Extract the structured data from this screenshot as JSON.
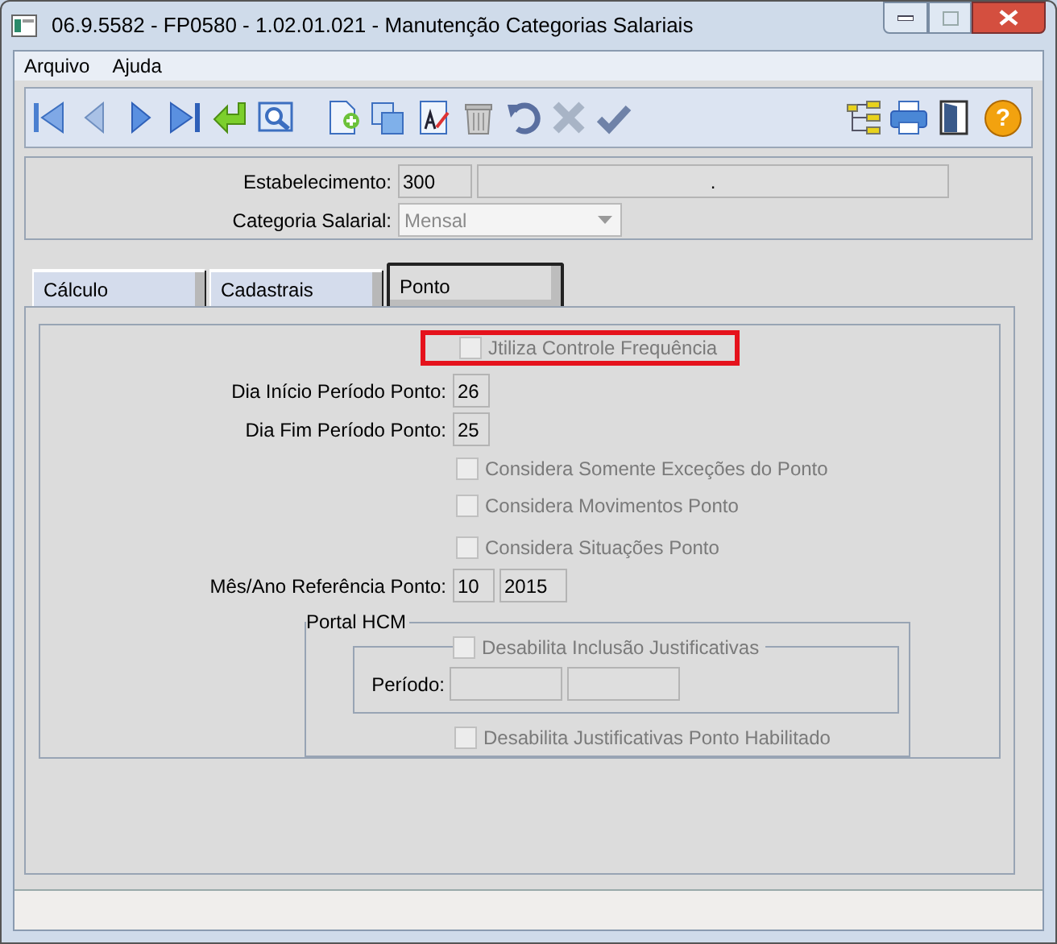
{
  "window": {
    "title": "06.9.5582 - FP0580 - 1.02.01.021 - Manutenção Categorias Salariais"
  },
  "menu": [
    {
      "label": "Arquivo"
    },
    {
      "label": "Ajuda"
    }
  ],
  "toolbar": {
    "help_label": "?"
  },
  "header": {
    "establishment_label": "Estabelecimento:",
    "establishment_code": "300",
    "establishment_name": ".",
    "category_label": "Categoria Salarial:",
    "category_value": "Mensal",
    "category_disabled": true
  },
  "tabs": [
    {
      "label": "Cálculo",
      "selected": false
    },
    {
      "label": "Cadastrais",
      "selected": false
    },
    {
      "label": "Ponto",
      "selected": true
    }
  ],
  "ponto": {
    "uses_frequency": {
      "label": "Jtiliza Controle Frequência",
      "checked": false,
      "disabled": true,
      "highlighted": true
    },
    "start_day": {
      "label": "Dia Início Período Ponto:",
      "value": "26"
    },
    "end_day": {
      "label": "Dia Fim Período Ponto:",
      "value": "25"
    },
    "options": [
      {
        "label": "Considera Somente Exceções do Ponto",
        "checked": false,
        "disabled": true
      },
      {
        "label": "Considera Movimentos Ponto",
        "checked": false,
        "disabled": true
      },
      {
        "label": "Considera Situações Ponto",
        "checked": false,
        "disabled": true
      }
    ],
    "reference": {
      "label": "Mês/Ano Referência Ponto:",
      "month": "10",
      "year": "2015"
    },
    "portal": {
      "title": "Portal HCM",
      "disable_inclusion": {
        "label": "Desabilita Inclusão Justificativas",
        "checked": false,
        "disabled": true
      },
      "period_label": "Período:",
      "disable_enabled": {
        "label": "Desabilita Justificativas Ponto Habilitado",
        "checked": false,
        "disabled": true
      }
    }
  }
}
